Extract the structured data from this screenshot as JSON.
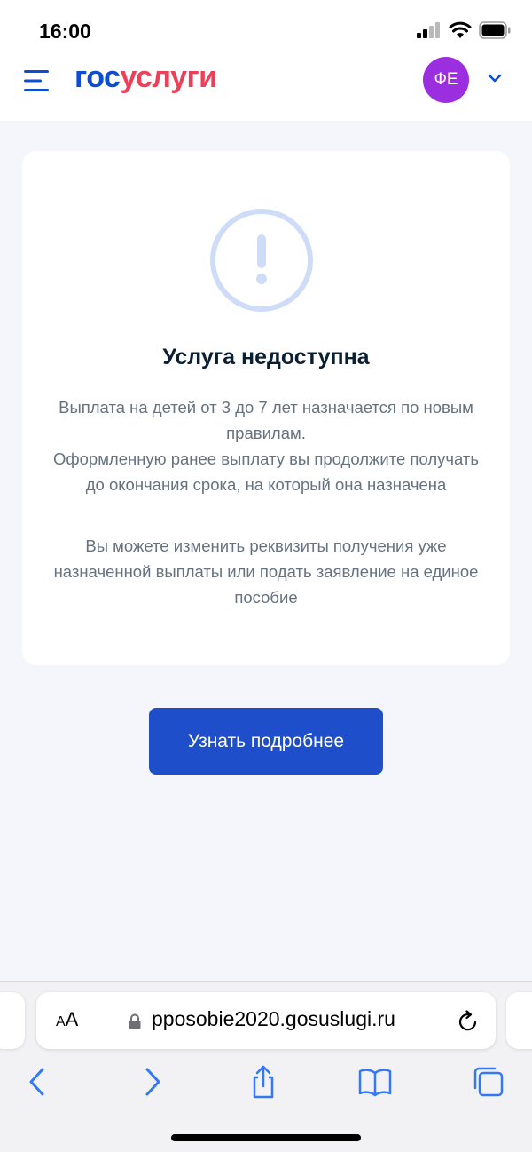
{
  "status_bar": {
    "time": "16:00",
    "icons": [
      "cellular-signal-icon",
      "wifi-icon",
      "battery-icon"
    ]
  },
  "header": {
    "logo_part1": "гос",
    "logo_part2": "услуги",
    "avatar_initials": "ФЕ",
    "colors": {
      "logo_blue": "#0d4cd3",
      "logo_red": "#ee3f58",
      "avatar_bg": "#9b2fe0"
    }
  },
  "card": {
    "icon": "exclamation-circle-icon",
    "title": "Услуга недоступна",
    "paragraph1": "Выплата на детей от 3 до 7 лет назначается по новым правилам.\nОформленную ранее выплату вы продолжите получать до окончания срока, на который она назначена",
    "paragraph2": "Вы можете изменить реквизиты получения уже назначенной выплаты или подать заявление на единое пособие"
  },
  "button": {
    "label": "Узнать подробнее",
    "color": "#1f4ecb"
  },
  "browser": {
    "aa_label_small": "A",
    "aa_label_large": "A",
    "url": "pposobie2020.gosuslugi.ru"
  }
}
